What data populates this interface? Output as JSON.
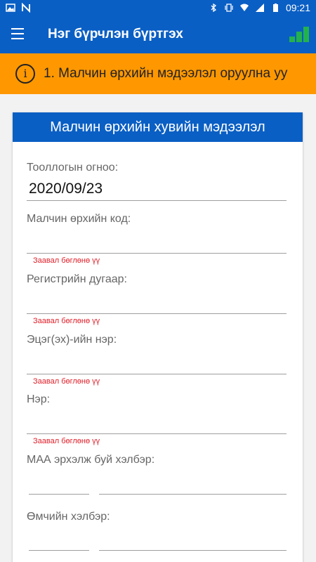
{
  "status": {
    "time": "09:21"
  },
  "appbar": {
    "title": "Нэг бүрчлэн бүртгэх"
  },
  "banner": {
    "text": "1. Малчин өрхийн мэдээлэл оруулна уу",
    "icon": "i"
  },
  "card": {
    "title": "Малчин өрхийн хувийн мэдээлэл",
    "fields": [
      {
        "label": "Тооллогын огноо:",
        "value": "2020/09/23"
      },
      {
        "label": "Малчин өрхийн код:",
        "value": "",
        "error": "Заавал бөглөнө үү"
      },
      {
        "label": "Регистрийн дугаар:",
        "value": "",
        "error": "Заавал бөглөнө үү"
      },
      {
        "label": "Эцэг(эх)-ийн нэр:",
        "value": "",
        "error": "Заавал бөглөнө үү"
      },
      {
        "label": "Нэр:",
        "value": "",
        "error": "Заавал бөглөнө үү"
      },
      {
        "label": "МАА эрхэлж буй хэлбэр:",
        "value": ""
      },
      {
        "label": "Өмчийн хэлбэр:",
        "value": ""
      }
    ]
  },
  "colors": {
    "primary": "#0a5fc4",
    "banner": "#ff9800",
    "error": "#e0202a",
    "signal": "#23b14d"
  }
}
